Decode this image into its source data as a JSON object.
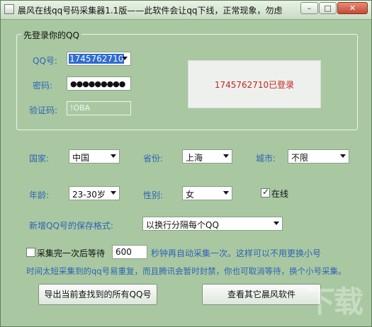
{
  "titlebar": {
    "title": "晨风在线qq号码采集器1.1版——此软件会让qq下线，正常现象，勿虑",
    "minimize": "–",
    "maximize": "□",
    "close": "✕"
  },
  "login_group": {
    "title": "先登录你的QQ",
    "qq_label": "QQ号:",
    "qq_value": "1745762710",
    "password_label": "密码:",
    "password_value": "●●●●●●●●●",
    "captcha_label": "验证码:",
    "captcha_value": "!OBA",
    "status_text": "1745762710已登录"
  },
  "filters": {
    "country_label": "国家:",
    "country_value": "中国",
    "province_label": "省份:",
    "province_value": "上海",
    "city_label": "城市:",
    "city_value": "不限",
    "age_label": "年龄:",
    "age_value": "23-30岁",
    "gender_label": "性别:",
    "gender_value": "女",
    "online_label": "在线",
    "online_checked": true
  },
  "save_format": {
    "label": "新增QQ号的保存格式:",
    "value": "以换行分隔每个QQ"
  },
  "auto_collect": {
    "checked": false,
    "label_before": "采集完一次后等待",
    "wait_value": "600",
    "label_after": "秒钟再自动采集一次。这样可以不用更换小号",
    "note": "时间太短采集到的qq号易重复，而且腾讯会暂时封禁，你也可取消等待，换个小号采集。"
  },
  "buttons": {
    "export": "导出当前查找到的所有QQ号",
    "other_software": "查看其它晨风软件"
  },
  "watermark": "下载"
}
